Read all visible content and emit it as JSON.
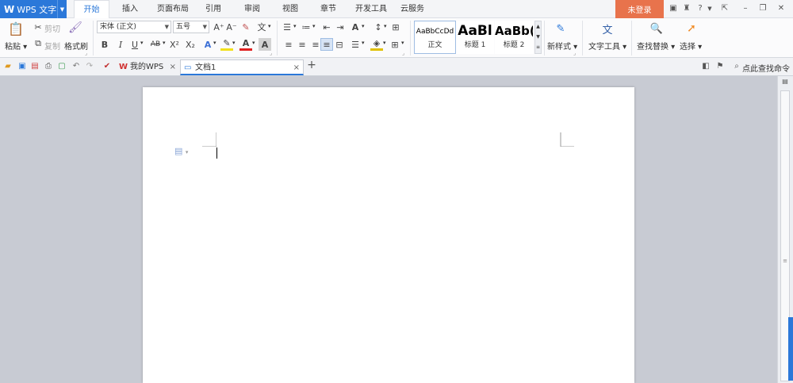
{
  "app": {
    "logo": "W",
    "name": "WPS 文字"
  },
  "menu": {
    "tabs": [
      "开始",
      "插入",
      "页面布局",
      "引用",
      "审阅",
      "视图",
      "章节",
      "开发工具",
      "云服务"
    ],
    "active_tab": "开始",
    "login": "未登录",
    "help": "?"
  },
  "ribbon": {
    "clipboard": {
      "paste": "粘贴",
      "cut": "剪切",
      "copy": "复制",
      "format_painter": "格式刷"
    },
    "font": {
      "name": "宋体 (正文)",
      "size": "五号"
    },
    "font_buttons": {
      "bold": "B",
      "italic": "I",
      "underline": "U",
      "strike": "AB",
      "superscript": "X²",
      "subscript": "X₂",
      "grow": "A⁺",
      "shrink": "A⁻"
    },
    "styles": [
      {
        "sample": "AaBbCcDd",
        "label": "正文"
      },
      {
        "sample": "AaBl",
        "label": "标题 1"
      },
      {
        "sample": "AaBb(",
        "label": "标题 2"
      }
    ],
    "new_style": "新样式",
    "text_tools": "文字工具",
    "find_replace": "查找替换",
    "select": "选择"
  },
  "doc_tabs": {
    "items": [
      {
        "label": "我的WPS",
        "close": "×"
      },
      {
        "label": "文档1",
        "close": "×"
      }
    ],
    "add": "+",
    "search_command": "点此查找命令"
  },
  "colors": {
    "accent": "#2b78d9",
    "login": "#e8734c",
    "workspace": "#c8cbd3"
  }
}
